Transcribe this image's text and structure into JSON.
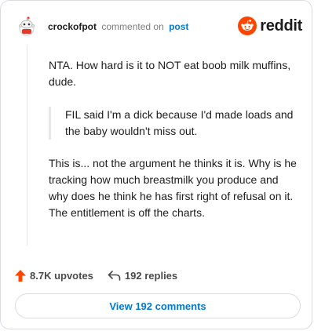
{
  "header": {
    "username": "crockofpot",
    "action": "commented on",
    "post_link": "post",
    "brand": "reddit"
  },
  "comment": {
    "paragraph1": "NTA. How hard is it to NOT eat boob milk muffins, dude.",
    "quote": "FIL said I'm a dick because I'd made loads and the baby wouldn't miss out.",
    "paragraph2": "This is... not the argument he thinks it is. Why is he tracking how much breastmilk you produce and why does he think he has first right of refusal on it. The entitlement is off the charts."
  },
  "stats": {
    "upvotes": "8.7K upvotes",
    "replies": "192 replies"
  },
  "footer": {
    "view_button": "View 192 comments"
  },
  "colors": {
    "accent": "#0079d3",
    "upvote": "#ff4500",
    "reddit_logo": "#ff4500"
  }
}
